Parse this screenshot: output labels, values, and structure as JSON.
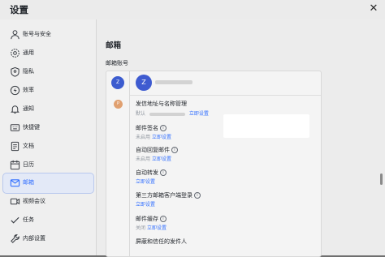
{
  "window": {
    "title": "设置",
    "close_icon": "close-icon"
  },
  "sidebar": {
    "items": [
      {
        "label": "账号与安全",
        "icon": "person-icon"
      },
      {
        "label": "通用",
        "icon": "gear-icon"
      },
      {
        "label": "隐私",
        "icon": "shield-icon"
      },
      {
        "label": "效率",
        "icon": "bolt-icon"
      },
      {
        "label": "通知",
        "icon": "bell-icon"
      },
      {
        "label": "快捷键",
        "icon": "keyboard-icon"
      },
      {
        "label": "文档",
        "icon": "document-icon"
      },
      {
        "label": "日历",
        "icon": "calendar-icon"
      },
      {
        "label": "邮箱",
        "icon": "mail-icon",
        "active": true
      },
      {
        "label": "视频会议",
        "icon": "video-icon"
      },
      {
        "label": "任务",
        "icon": "check-icon"
      },
      {
        "label": "内部设置",
        "icon": "wrench-icon"
      }
    ]
  },
  "main": {
    "heading": "邮箱",
    "accounts_label": "邮箱账号",
    "avatars": [
      "Z",
      "P"
    ],
    "account_avatar": "Z",
    "settings": [
      {
        "title": "发信地址与名称管理",
        "prefix": "默认",
        "link": "立即设置",
        "info": false
      },
      {
        "title": "邮件签名",
        "status": "未启用",
        "link": "立即设置",
        "info": true
      },
      {
        "title": "自动回复邮件",
        "status": "未启用",
        "link": "立即设置",
        "info": true
      },
      {
        "title": "自动转发",
        "link": "立即设置",
        "info": true
      },
      {
        "title": "第三方邮箱客户端登录",
        "link": "立即设置",
        "info": true
      },
      {
        "title": "邮件缓存",
        "status": "关闭",
        "link": "立即设置",
        "info": true
      },
      {
        "title": "屏蔽和信任的发件人"
      }
    ]
  },
  "colors": {
    "accent": "#3370ff",
    "active_bg": "#e3e9f7",
    "avatar_blue": "#3e5bd0",
    "avatar_orange": "#e0a070"
  }
}
